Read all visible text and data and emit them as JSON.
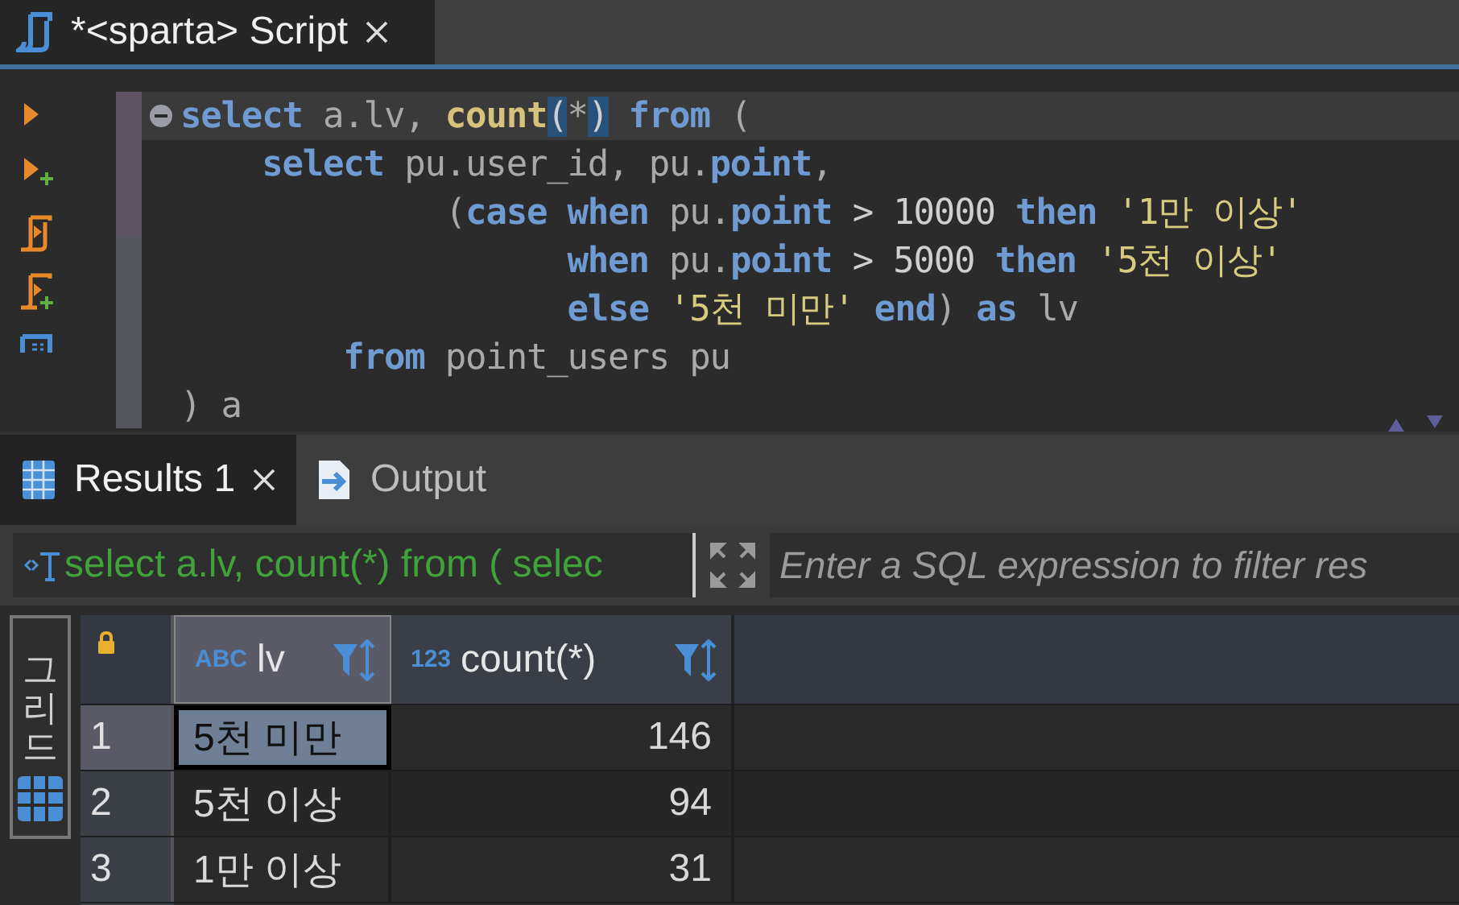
{
  "editor_tab": {
    "title": "*<sparta> Script",
    "selected": true
  },
  "code_lines": [
    {
      "current": true,
      "tokens": [
        {
          "text": "select",
          "kind": "kw"
        },
        {
          "text": " a.lv, ",
          "kind": "id"
        },
        {
          "text": "count",
          "kind": "fn"
        },
        {
          "text": "(",
          "kind": "match"
        },
        {
          "text": "*",
          "kind": "id"
        },
        {
          "text": ")",
          "kind": "match"
        },
        {
          "text": " from",
          "kind": "kw"
        },
        {
          "text": " (",
          "kind": "id"
        }
      ]
    },
    {
      "current": false,
      "tokens": [
        {
          "text": "    select",
          "kind": "kw"
        },
        {
          "text": " pu.user_id, pu.",
          "kind": "id"
        },
        {
          "text": "point",
          "kind": "kw"
        },
        {
          "text": ",",
          "kind": "id"
        }
      ]
    },
    {
      "current": false,
      "tokens": [
        {
          "text": "             (",
          "kind": "id"
        },
        {
          "text": "case",
          "kind": "kw"
        },
        {
          "text": " when",
          "kind": "kw"
        },
        {
          "text": " pu.",
          "kind": "id"
        },
        {
          "text": "point",
          "kind": "kw"
        },
        {
          "text": " > 10000 ",
          "kind": "num"
        },
        {
          "text": "then",
          "kind": "kw"
        },
        {
          "text": " '1만 이상'",
          "kind": "str"
        }
      ]
    },
    {
      "current": false,
      "tokens": [
        {
          "text": "                   when",
          "kind": "kw"
        },
        {
          "text": " pu.",
          "kind": "id"
        },
        {
          "text": "point",
          "kind": "kw"
        },
        {
          "text": " > 5000 ",
          "kind": "num"
        },
        {
          "text": "then",
          "kind": "kw"
        },
        {
          "text": " '5천 이상'",
          "kind": "str"
        }
      ]
    },
    {
      "current": false,
      "tokens": [
        {
          "text": "                   else",
          "kind": "kw"
        },
        {
          "text": " '5천 미만'",
          "kind": "str"
        },
        {
          "text": " end",
          "kind": "kw"
        },
        {
          "text": ") ",
          "kind": "id"
        },
        {
          "text": "as",
          "kind": "kw"
        },
        {
          "text": " lv",
          "kind": "id"
        }
      ]
    },
    {
      "current": false,
      "tokens": [
        {
          "text": "        from",
          "kind": "kw"
        },
        {
          "text": " point_users pu",
          "kind": "id"
        }
      ]
    },
    {
      "current": false,
      "tokens": [
        {
          "text": ") a",
          "kind": "id"
        }
      ]
    }
  ],
  "result_tabs": [
    {
      "label": "Results 1",
      "selected": true,
      "kind": "grid"
    },
    {
      "label": "Output",
      "selected": false,
      "kind": "output"
    }
  ],
  "filter_bar": {
    "query": "select a.lv, count(*) from ( selec",
    "placeholder": "Enter a SQL expression to filter res"
  },
  "side_tabs": [
    {
      "label": "그리드",
      "selected": true
    }
  ],
  "table": {
    "columns": [
      {
        "type": "ABC",
        "label": "lv",
        "selected": true
      },
      {
        "type": "123",
        "label": "count(*)",
        "selected": false
      }
    ],
    "rows": [
      {
        "number": "1",
        "cells": [
          "5천 미만",
          "146"
        ],
        "selected": true
      },
      {
        "number": "2",
        "cells": [
          "5천 이상",
          "94"
        ],
        "selected": false
      },
      {
        "number": "3",
        "cells": [
          "1만 이상",
          "31"
        ],
        "selected": false
      }
    ]
  }
}
